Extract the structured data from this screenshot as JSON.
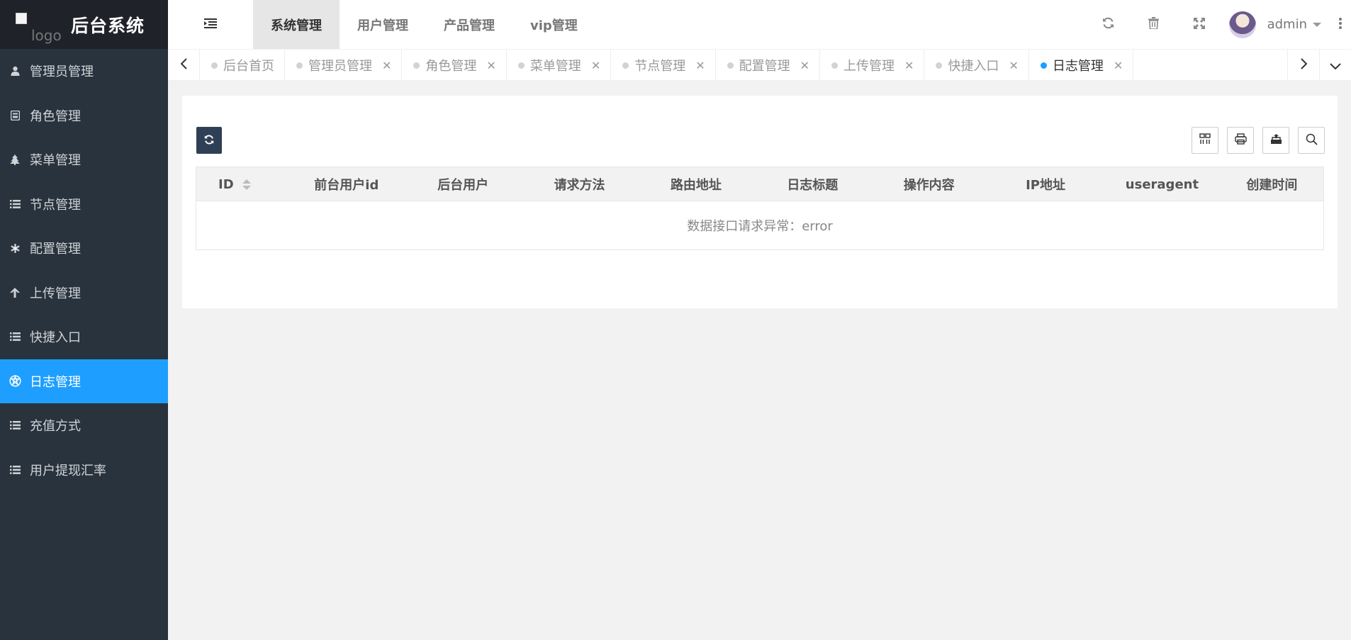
{
  "app": {
    "logo_alt": "logo",
    "title": "后台系统"
  },
  "sidebar": {
    "items": [
      {
        "label": "管理员管理",
        "icon": "user-icon"
      },
      {
        "label": "角色管理",
        "icon": "role-icon"
      },
      {
        "label": "菜单管理",
        "icon": "tree-icon"
      },
      {
        "label": "节点管理",
        "icon": "list-icon"
      },
      {
        "label": "配置管理",
        "icon": "asterisk-icon"
      },
      {
        "label": "上传管理",
        "icon": "arrow-up-icon"
      },
      {
        "label": "快捷入口",
        "icon": "list-icon"
      },
      {
        "label": "日志管理",
        "icon": "log-icon",
        "active": true
      },
      {
        "label": "充值方式",
        "icon": "list-icon"
      },
      {
        "label": "用户提现汇率",
        "icon": "list-icon"
      }
    ]
  },
  "header": {
    "nav": [
      {
        "label": "系统管理",
        "active": true
      },
      {
        "label": "用户管理"
      },
      {
        "label": "产品管理"
      },
      {
        "label": "vip管理"
      }
    ],
    "user_name": "admin"
  },
  "tabs": [
    {
      "label": "后台首页",
      "closable": false
    },
    {
      "label": "管理员管理",
      "closable": true
    },
    {
      "label": "角色管理",
      "closable": true
    },
    {
      "label": "菜单管理",
      "closable": true
    },
    {
      "label": "节点管理",
      "closable": true
    },
    {
      "label": "配置管理",
      "closable": true
    },
    {
      "label": "上传管理",
      "closable": true
    },
    {
      "label": "快捷入口",
      "closable": true
    },
    {
      "label": "日志管理",
      "closable": true,
      "active": true
    }
  ],
  "table": {
    "columns": [
      "ID",
      "前台用户id",
      "后台用户",
      "请求方法",
      "路由地址",
      "日志标题",
      "操作内容",
      "IP地址",
      "useragent",
      "创建时间"
    ],
    "empty_text": "数据接口请求异常：error"
  },
  "colors": {
    "sidebar_bg": "#28333e",
    "logo_bg": "#20222a",
    "accent": "#1e9fff",
    "refresh_btn": "#2f4056"
  }
}
